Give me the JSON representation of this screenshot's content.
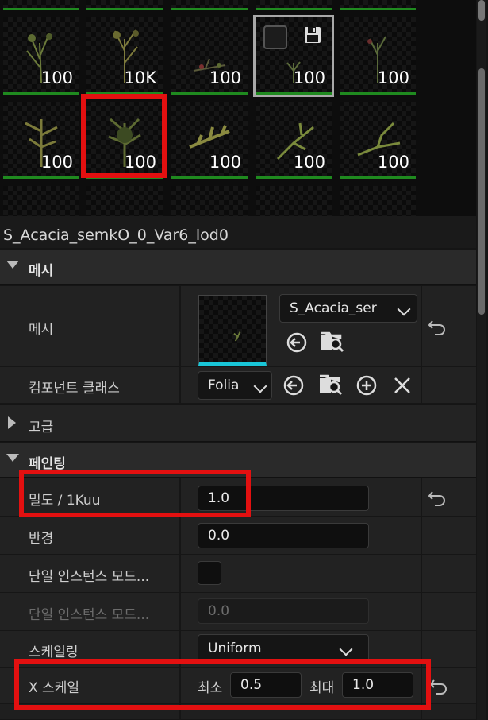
{
  "asset_grid": {
    "counts": [
      "100",
      "10K",
      "100",
      "100",
      "100",
      "100",
      "100",
      "100",
      "100",
      "100"
    ]
  },
  "details": {
    "title": "S_Acacia_semkO_0_Var6_lod0",
    "mesh_section": {
      "header": "메시",
      "mesh_label": "메시",
      "mesh_combo_value": "S_Acacia_ser",
      "component_label": "컴포넌트 클래스",
      "component_combo_value": "Folia"
    },
    "advanced_section": {
      "header": "고급"
    },
    "painting_section": {
      "header": "페인팅",
      "density_label": "밀도 / 1Kuu",
      "density_value": "1.0",
      "radius_label": "반경",
      "radius_value": "0.0",
      "single_instance_label": "단일 인스턴스 모드...",
      "single_instance_label2": "단일 인스턴스 모드...",
      "single_instance_value": "0.0",
      "scaling_label": "스케일링",
      "scaling_value": "Uniform",
      "xscale_label": "X 스케일",
      "min_label": "최소",
      "min_value": "0.5",
      "max_label": "최대",
      "max_value": "1.0"
    }
  },
  "colors": {
    "accent_cyan": "#19c6d8",
    "count_bar_green": "#1f8a1f",
    "highlight_red": "#e31010"
  }
}
